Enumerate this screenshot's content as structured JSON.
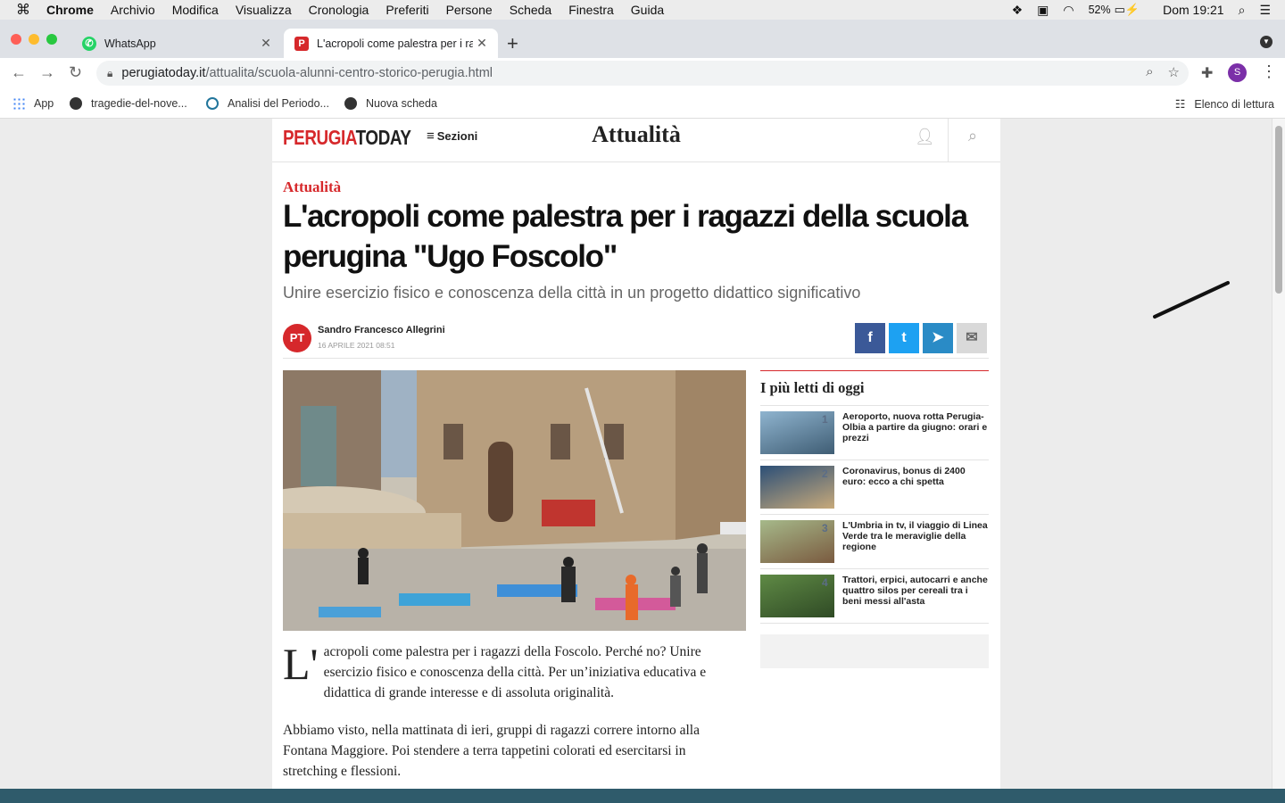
{
  "menubar": {
    "app_name": "Chrome",
    "items": [
      "Archivio",
      "Modifica",
      "Visualizza",
      "Cronologia",
      "Preferiti",
      "Persone",
      "Scheda",
      "Finestra",
      "Guida"
    ],
    "battery": "52%",
    "clock": "Dom 19:21"
  },
  "tabs": [
    {
      "title": "WhatsApp",
      "favicon_color": "#25d366"
    },
    {
      "title": "L'acropoli come palestra per i ragazzi",
      "favicon_color": "#d6282b"
    }
  ],
  "omnibox": {
    "host": "perugiatoday.it",
    "path": "/attualita/scuola-alunni-centro-storico-perugia.html"
  },
  "profile_initial": "S",
  "bookmarks": [
    {
      "label": "App"
    },
    {
      "label": "tragedie-del-nove..."
    },
    {
      "label": "Analisi del Periodo..."
    },
    {
      "label": "Nuova scheda"
    }
  ],
  "reading_list": "Elenco di lettura",
  "site": {
    "logo_part1": "PERUGIA",
    "logo_part2": "TODAY",
    "sections_label": "Sezioni",
    "section_title": "Attualità",
    "brand_red": "#d6282b"
  },
  "article": {
    "kicker": "Attualità",
    "headline": "L'acropoli come palestra per i ragazzi della scuola perugina \"Ugo Foscolo\"",
    "subtitle": "Unire esercizio fisico e conoscenza della città in un progetto didattico significativo",
    "author": "Sandro Francesco Allegrini",
    "date": "16 APRILE 2021 08:51",
    "avatar_initials": "PT",
    "dropcap": "L'",
    "para1": "acropoli come palestra per i ragazzi della Foscolo. Perché no? Unire esercizio fisico e conoscenza della città. Per un’iniziativa educativa e didattica di grande interesse e di assoluta originalità.",
    "para2": "Abbiamo visto, nella mattinata di ieri, gruppi di ragazzi correre intorno alla Fontana Maggiore. Poi stendere a terra tappetini colorati ed esercitarsi in stretching e flessioni."
  },
  "share": [
    {
      "icon": "facebook-icon",
      "glyph": "f",
      "color": "#3b5998"
    },
    {
      "icon": "twitter-icon",
      "glyph": "t",
      "color": "#1da1f2"
    },
    {
      "icon": "telegram-icon",
      "glyph": "➤",
      "color": "#2a8bc6"
    },
    {
      "icon": "mail-icon",
      "glyph": "✉",
      "color": "#d9d9d9"
    }
  ],
  "most_read": {
    "heading": "I più letti di oggi",
    "items": [
      {
        "num": "1",
        "title": "Aeroporto, nuova rotta Perugia-Olbia a partire da giugno: orari e prezzi"
      },
      {
        "num": "2",
        "title": "Coronavirus, bonus di 2400 euro: ecco a chi spetta"
      },
      {
        "num": "3",
        "title": "L'Umbria in tv, il viaggio di Linea Verde tra le meraviglie della regione"
      },
      {
        "num": "4",
        "title": "Trattori, erpici, autocarri e anche quattro silos per cereali tra i beni messi all'asta"
      }
    ]
  }
}
